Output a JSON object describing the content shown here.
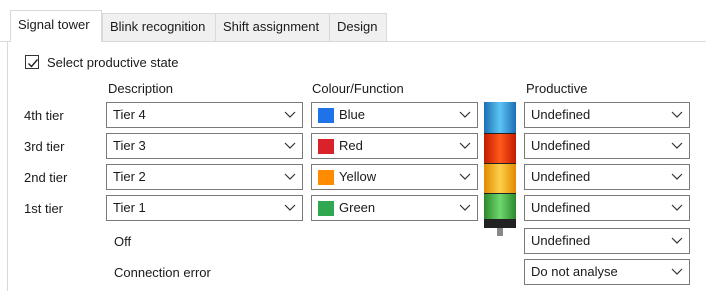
{
  "tabs": [
    {
      "label": "Signal tower",
      "active": true
    },
    {
      "label": "Blink recognition",
      "active": false
    },
    {
      "label": "Shift assignment",
      "active": false
    },
    {
      "label": "Design",
      "active": false
    }
  ],
  "select_productive_state": {
    "label": "Select productive state",
    "checked": true
  },
  "headers": {
    "description": "Description",
    "colour_function": "Colour/Function",
    "productive": "Productive"
  },
  "tiers": [
    {
      "label": "4th tier",
      "description": "Tier 4",
      "colour": "Blue",
      "colour_hex": "#1e73e8",
      "productive": "Undefined"
    },
    {
      "label": "3rd tier",
      "description": "Tier 3",
      "colour": "Red",
      "colour_hex": "#d9222a",
      "productive": "Undefined"
    },
    {
      "label": "2nd tier",
      "description": "Tier 2",
      "colour": "Yellow",
      "colour_hex": "#ff8c00",
      "productive": "Undefined"
    },
    {
      "label": "1st tier",
      "description": "Tier 1",
      "colour": "Green",
      "colour_hex": "#2fa84f",
      "productive": "Undefined"
    }
  ],
  "off": {
    "label": "Off",
    "productive": "Undefined"
  },
  "connection_error": {
    "label": "Connection error",
    "productive": "Do not analyse"
  }
}
